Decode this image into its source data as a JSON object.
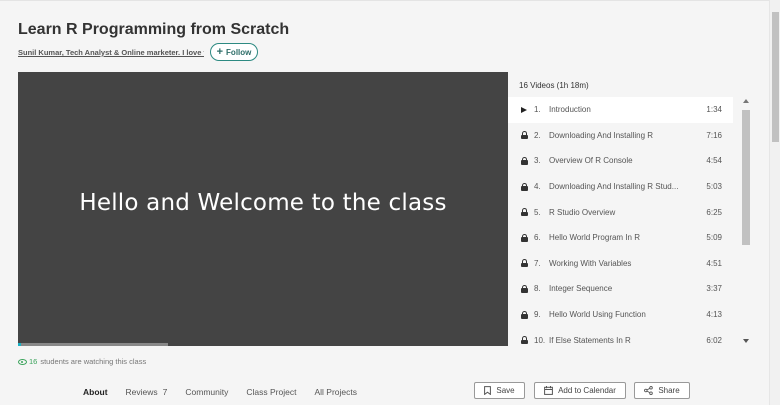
{
  "class": {
    "title": "Learn R Programming from Scratch",
    "teacher_line": "Sunil Kumar, Tech Analyst & Online marketer. I love t",
    "follow_label": "Follow"
  },
  "video": {
    "slide_text": "Hello and Welcome to the class",
    "progress_fraction": 0.02
  },
  "playlist": {
    "header": "16 Videos (1h 18m)",
    "items": [
      {
        "num": "1.",
        "name": "Introduction",
        "duration": "1:34",
        "state": "playing"
      },
      {
        "num": "2.",
        "name": "Downloading And Installing R",
        "duration": "7:16",
        "state": "locked"
      },
      {
        "num": "3.",
        "name": "Overview Of R Console",
        "duration": "4:54",
        "state": "locked"
      },
      {
        "num": "4.",
        "name": "Downloading And Installing R Stud...",
        "duration": "5:03",
        "state": "locked"
      },
      {
        "num": "5.",
        "name": "R Studio Overview",
        "duration": "6:25",
        "state": "locked"
      },
      {
        "num": "6.",
        "name": "Hello World Program In R",
        "duration": "5:09",
        "state": "locked"
      },
      {
        "num": "7.",
        "name": "Working With Variables",
        "duration": "4:51",
        "state": "locked"
      },
      {
        "num": "8.",
        "name": "Integer Sequence",
        "duration": "3:37",
        "state": "locked"
      },
      {
        "num": "9.",
        "name": "Hello World Using Function",
        "duration": "4:13",
        "state": "locked"
      },
      {
        "num": "10.",
        "name": "If Else Statements In R",
        "duration": "6:02",
        "state": "locked"
      }
    ]
  },
  "watching": {
    "count": "16",
    "text": "students are watching this class"
  },
  "tabs": {
    "about": "About",
    "reviews": "Reviews",
    "reviews_count": "7",
    "community": "Community",
    "class_project": "Class Project",
    "all_projects": "All Projects"
  },
  "actions": {
    "save": "Save",
    "add_to_calendar": "Add to Calendar",
    "share": "Share"
  },
  "colors": {
    "accent": "#2d8a82",
    "progress": "#1ab1c4",
    "watching_green": "#3aa35b",
    "video_bg": "#444444"
  }
}
